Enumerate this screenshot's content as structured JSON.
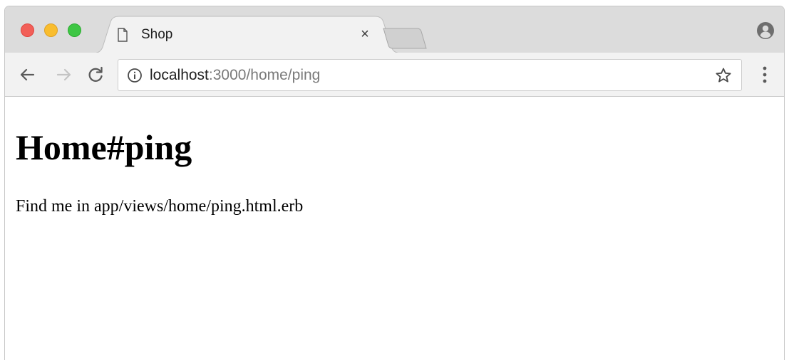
{
  "browser": {
    "tab": {
      "title": "Shop",
      "close_glyph": "×",
      "favicon": "page-icon"
    },
    "toolbar": {
      "back_icon": "arrow-left-icon",
      "forward_icon": "arrow-right-icon",
      "reload_icon": "reload-icon",
      "menu_icon": "kebab-menu-icon"
    },
    "address_bar": {
      "host": "localhost",
      "path": ":3000/home/ping",
      "security_icon": "info-icon",
      "bookmark_icon": "star-icon"
    },
    "profile_icon": "profile-icon"
  },
  "page": {
    "heading": "Home#ping",
    "body_text": "Find me in app/views/home/ping.html.erb"
  },
  "colors": {
    "traffic_red": "#f25f58",
    "traffic_yellow": "#f9bd2e",
    "traffic_green": "#3ec644",
    "tabstrip": "#dcdcdc",
    "toolbar": "#f2f2f2"
  }
}
